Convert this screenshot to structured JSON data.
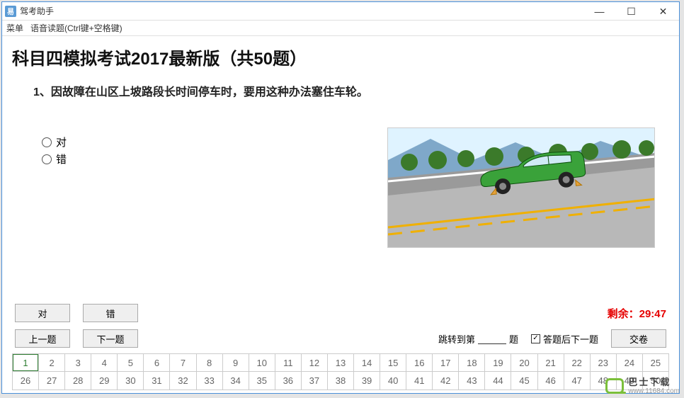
{
  "titlebar": {
    "app_name": "驾考助手",
    "icon_letter": "易"
  },
  "menubar": {
    "menu": "菜单",
    "voice": "语音读题(Ctrl键+空格键)"
  },
  "heading": "科目四模拟考试2017最新版（共50题）",
  "question": {
    "text": "1、因故障在山区上坡路段长时间停车时，要用这种办法塞住车轮。"
  },
  "options": {
    "opt_true": "对",
    "opt_false": "错"
  },
  "buttons": {
    "true": "对",
    "false": "错",
    "prev": "上一题",
    "next": "下一题",
    "submit": "交卷"
  },
  "timer": {
    "label": "剩余：",
    "value": "29:47"
  },
  "jump": {
    "prefix": "跳转到第",
    "suffix": "题",
    "value": ""
  },
  "auto_next": {
    "label": "答题后下一题",
    "checked": true
  },
  "grid": {
    "active": 1,
    "cells_row1": [
      "1",
      "2",
      "3",
      "4",
      "5",
      "6",
      "7",
      "8",
      "9",
      "10",
      "11",
      "12",
      "13",
      "14",
      "15",
      "16",
      "17",
      "18",
      "19",
      "20",
      "21",
      "22",
      "23",
      "24",
      "25"
    ],
    "cells_row2": [
      "26",
      "27",
      "28",
      "29",
      "30",
      "31",
      "32",
      "33",
      "34",
      "35",
      "36",
      "37",
      "38",
      "39",
      "40",
      "41",
      "42",
      "43",
      "44",
      "45",
      "46",
      "47",
      "48",
      "49",
      "50"
    ]
  },
  "watermark": {
    "main": "巴士下载",
    "sub": "www.11684.com"
  }
}
